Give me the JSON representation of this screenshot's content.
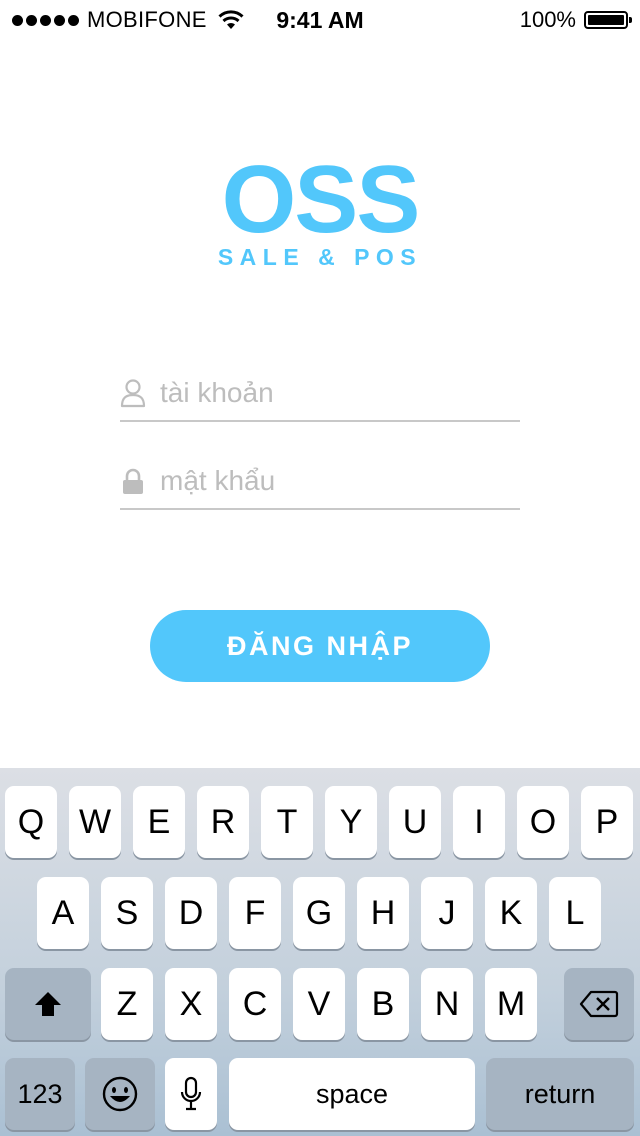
{
  "status_bar": {
    "carrier": "MOBIFONE",
    "time": "9:41 AM",
    "battery": "100%"
  },
  "logo": {
    "title": "OSS",
    "subtitle": "SALE & POS"
  },
  "form": {
    "username_placeholder": "tài khoản",
    "password_placeholder": "mật khẩu",
    "login_label": "ĐĂNG NHẬP"
  },
  "keyboard": {
    "row1": [
      "Q",
      "W",
      "E",
      "R",
      "T",
      "Y",
      "U",
      "I",
      "O",
      "P"
    ],
    "row2": [
      "A",
      "S",
      "D",
      "F",
      "G",
      "H",
      "J",
      "K",
      "L"
    ],
    "row3": [
      "Z",
      "X",
      "C",
      "V",
      "B",
      "N",
      "M"
    ],
    "numbers_label": "123",
    "space_label": "space",
    "return_label": "return"
  },
  "colors": {
    "accent": "#52c7fb"
  }
}
